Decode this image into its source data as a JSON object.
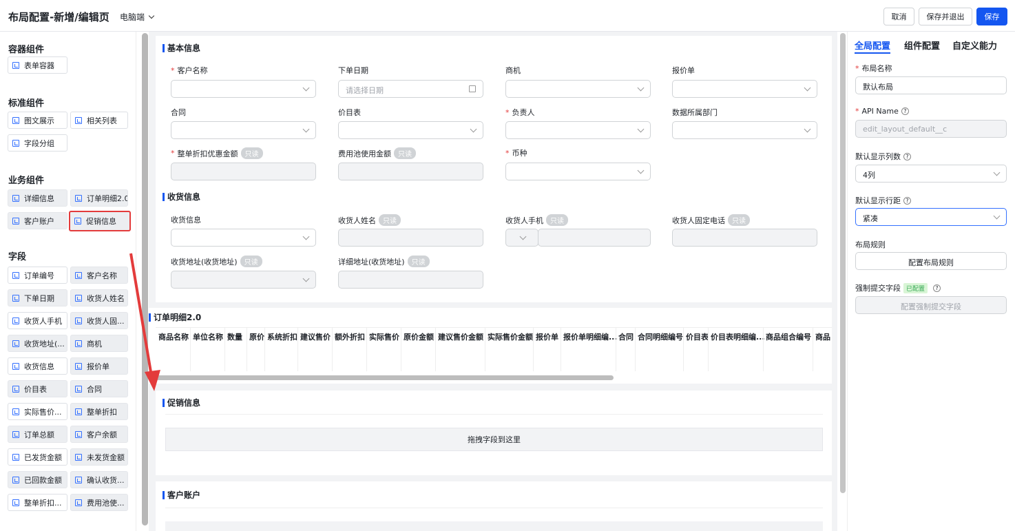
{
  "header": {
    "title": "布局配置-新增/编辑页",
    "device": "电脑端",
    "cancel": "取消",
    "save_exit": "保存并退出",
    "save": "保存"
  },
  "left": {
    "container_title": "容器组件",
    "container_items": [
      "表单容器"
    ],
    "standard_title": "标准组件",
    "standard_items": [
      "图文展示",
      "相关列表",
      "字段分组"
    ],
    "business_title": "业务组件",
    "business_items": [
      "详细信息",
      "订单明细2.0",
      "客户账户",
      "促销信息"
    ],
    "fields_title": "字段",
    "fields": [
      "订单编号",
      "客户名称",
      "下单日期",
      "收货人姓名",
      "收货人手机",
      "收货人固...",
      "收货地址(...",
      "商机",
      "收货信息",
      "报价单",
      "价目表",
      "合同",
      "实际售价...",
      "整单折扣",
      "订单总额",
      "客户余额",
      "已发货金额",
      "未发货金额",
      "已回款金额",
      "确认收货...",
      "整单折扣...",
      "费用池使..."
    ]
  },
  "basic": {
    "title": "基本信息",
    "f1": "客户名称",
    "f2": "下单日期",
    "f2_ph": "请选择日期",
    "f3": "商机",
    "f4": "报价单",
    "f5": "合同",
    "f6": "价目表",
    "f7": "负责人",
    "f8": "数据所属部门",
    "f9": "整单折扣优惠金额",
    "f10": "费用池使用金额",
    "f11": "币种",
    "readonly": "只读"
  },
  "shipping": {
    "title": "收货信息",
    "f1": "收货信息",
    "f2": "收货人姓名",
    "f3": "收货人手机",
    "f4": "收货人固定电话",
    "f5": "收货地址(收货地址)",
    "f6": "详细地址(收货地址)"
  },
  "order_detail": {
    "title": "订单明细2.0",
    "columns": [
      "商品名称",
      "单位名称",
      "数量",
      "原价",
      "系统折扣",
      "建议售价",
      "额外折扣",
      "实际售价",
      "原价金额",
      "建议售价金额",
      "实际售价金额",
      "报价单",
      "报价单明细编...",
      "合同",
      "合同明细编号",
      "价目表",
      "价目表明细编...",
      "商品组合编号",
      "商品"
    ]
  },
  "promo": {
    "title": "促销信息",
    "drop": "拖拽字段到这里"
  },
  "account": {
    "title": "客户账户"
  },
  "right": {
    "tab1": "全局配置",
    "tab2": "组件配置",
    "tab3": "自定义能力",
    "layout_name_label": "布局名称",
    "layout_name": "默认布局",
    "api_label": "API Name",
    "api_value": "edit_layout_default__c",
    "cols_label": "默认显示列数",
    "cols_value": "4列",
    "row_label": "默认显示行距",
    "row_value": "紧凑",
    "rules_label": "布局规则",
    "rules_btn": "配置布局规则",
    "force_label": "强制提交字段",
    "force_badge": "已配置",
    "force_btn": "配置强制提交字段"
  }
}
